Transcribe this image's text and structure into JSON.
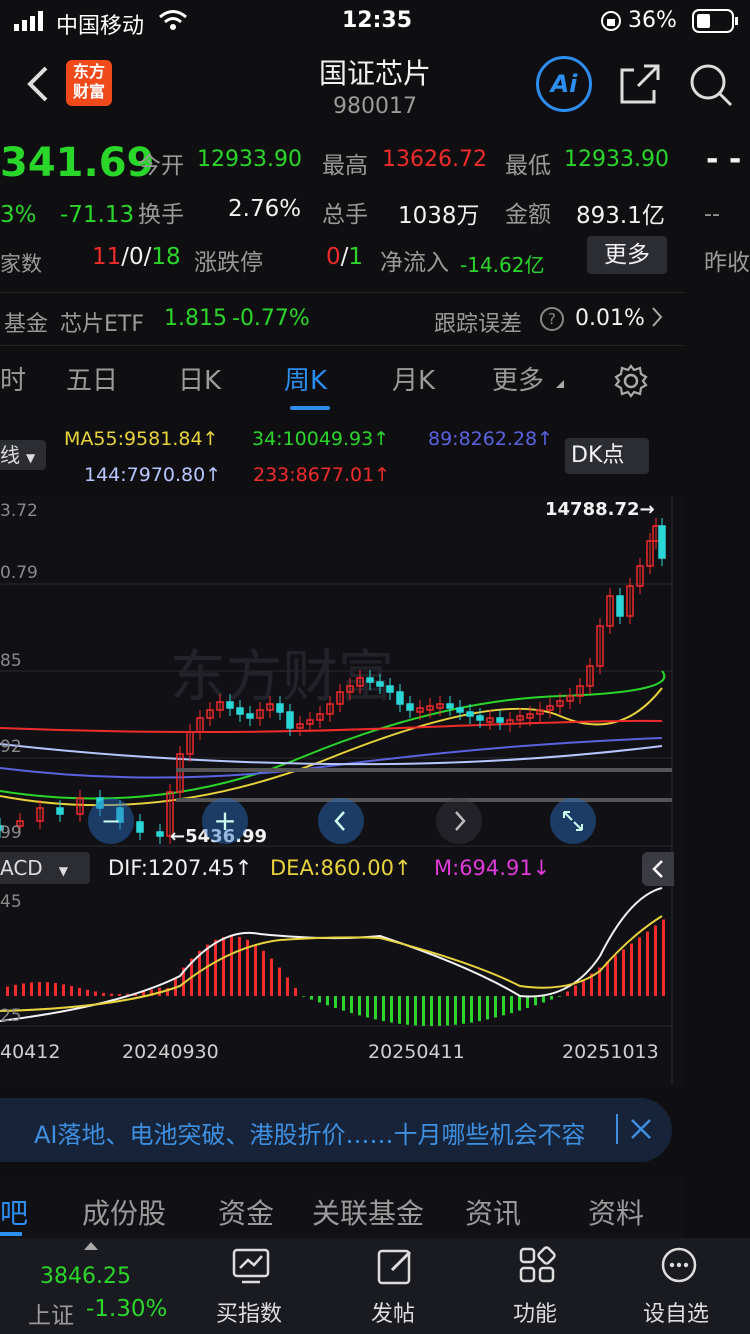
{
  "status_bar": {
    "carrier": "中国移动",
    "time": "12:35",
    "battery": "36%"
  },
  "header": {
    "title": "国证芯片",
    "code": "980017",
    "logo_line1": "东方",
    "logo_line2": "财富",
    "ai_label": "Ai"
  },
  "quote": {
    "price": "341.69",
    "change_pct": "3%",
    "change": "-71.13",
    "open_label": "今开",
    "open": "12933.90",
    "high_label": "最高",
    "high": "13626.72",
    "low_label": "最低",
    "low": "12933.90",
    "turnover_label": "换手",
    "turnover": "2.76%",
    "volume_label": "总手",
    "volume": "1038万",
    "amount_label": "金额",
    "amount": "893.1亿",
    "count_label": "家数",
    "count_up": "11",
    "count_sep1": "/",
    "count_flat": "0",
    "count_sep2": "/",
    "count_down": "18",
    "limit_label": "涨跌停",
    "limit_up": "0",
    "limit_sep": "/",
    "limit_down": "1",
    "netflow_label": "净流入",
    "netflow": "-14.62亿",
    "more_button": "更多",
    "right_dash1": "- -",
    "right_dash2": "--",
    "right_label": "昨收"
  },
  "fund": {
    "label": "基金",
    "name": "芯片ETF",
    "price": "1.815",
    "change": "-0.77%",
    "err_label": "跟踪误差",
    "err_value": "0.01%"
  },
  "tabs": {
    "items": [
      "时",
      "五日",
      "日K",
      "周K",
      "月K",
      "更多"
    ],
    "active": "周K"
  },
  "ma": {
    "line_select": "线",
    "ma55": "MA55:9581.84↑",
    "ma34": "34:10049.93↑",
    "ma89": "89:8262.28↑",
    "ma144": "144:7970.80↑",
    "ma233": "233:8677.01↑",
    "dk_button": "DK点"
  },
  "chart_data": {
    "type": "candlestick",
    "y_labels": [
      "3.72",
      "0.79",
      "85",
      "92",
      "99"
    ],
    "max_label": "14788.72→",
    "min_label": "←5436.99",
    "watermark": "东方财富",
    "macd_select": "ACD",
    "dif": "DIF:1207.45↑",
    "dea": "DEA:860.00↑",
    "m": "M:694.91↓",
    "macd_y_labels": [
      "45",
      "25"
    ],
    "x_labels": [
      "40412",
      "20240930",
      "20250411",
      "20251013"
    ]
  },
  "banner": {
    "text": "AI落地、电池突破、港股折价……十月哪些机会不容"
  },
  "bottom_tabs": {
    "items": [
      "吧",
      "成份股",
      "资金",
      "关联基金",
      "资讯",
      "资料"
    ]
  },
  "bottom_bar": {
    "index_value": "3846.25",
    "index_name": "上证",
    "index_change": "-1.30%",
    "items": [
      "买指数",
      "发帖",
      "功能",
      "设自选"
    ]
  },
  "colors": {
    "up": "#f02b2b",
    "down": "#2bd62b",
    "accent": "#2b8ef0",
    "bg": "#0f0f12"
  }
}
